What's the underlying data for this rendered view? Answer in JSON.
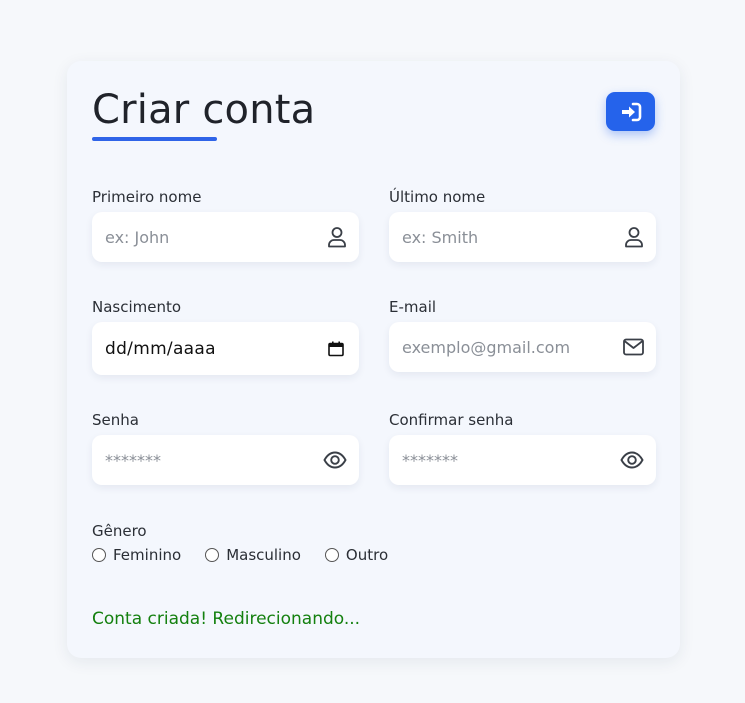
{
  "form": {
    "title": "Criar conta",
    "login_button_icon": "sign-in-icon",
    "first_name": {
      "label": "Primeiro nome",
      "placeholder": "ex: John",
      "icon": "user-icon"
    },
    "last_name": {
      "label": "Último nome",
      "placeholder": "ex: Smith",
      "icon": "user-icon"
    },
    "birth_date": {
      "label": "Nascimento",
      "placeholder": "dd/mm/aaaa",
      "icon": "calendar-icon"
    },
    "email": {
      "label": "E-mail",
      "placeholder": "exemplo@gmail.com",
      "icon": "envelope-icon"
    },
    "password": {
      "label": "Senha",
      "placeholder": "*******",
      "icon": "eye-icon"
    },
    "confirm_password": {
      "label": "Confirmar senha",
      "placeholder": "*******",
      "icon": "eye-icon"
    },
    "gender": {
      "label": "Gênero",
      "options": [
        "Feminino",
        "Masculino",
        "Outro"
      ]
    },
    "status": "Conta criada! Redirecionando..."
  },
  "colors": {
    "accent": "#2563eb",
    "success": "#14800f",
    "background": "#f6f8fb"
  }
}
